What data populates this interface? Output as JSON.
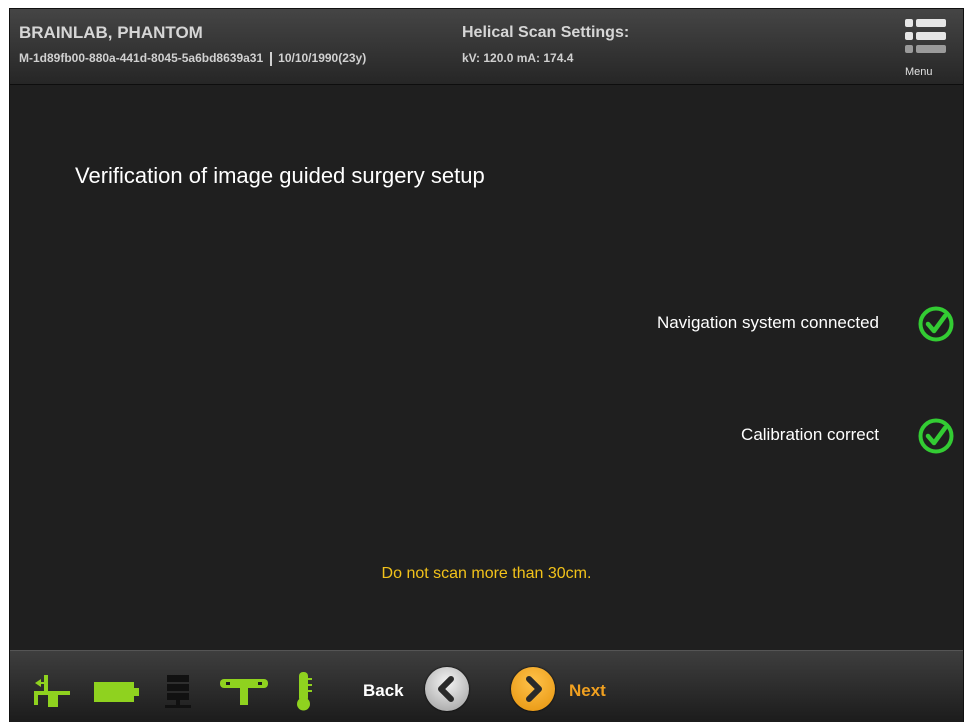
{
  "header": {
    "patient_name": "BRAINLAB, PHANTOM",
    "patient_id": "M-1d89fb00-880a-441d-8045-5a6bd8639a31",
    "patient_dob": "10/10/1990(23y)",
    "scan_title": "Helical Scan Settings:",
    "scan_values": "kV:  120.0   mA:  174.4",
    "menu_label": "Menu"
  },
  "main": {
    "title": "Verification of image guided surgery setup",
    "checks": [
      {
        "label": "Navigation system connected",
        "status": "ok"
      },
      {
        "label": "Calibration correct",
        "status": "ok"
      }
    ],
    "warning": "Do not scan more than 30cm."
  },
  "footer": {
    "status_icons": [
      "table-position-icon",
      "battery-icon",
      "network-icon",
      "gantry-icon",
      "thermometer-icon"
    ],
    "back_label": "Back",
    "next_label": "Next"
  },
  "colors": {
    "status_ok": "#33cc33",
    "status_icon": "#8fd21f",
    "warning": "#f2c21a",
    "next_accent": "#f0a020"
  }
}
